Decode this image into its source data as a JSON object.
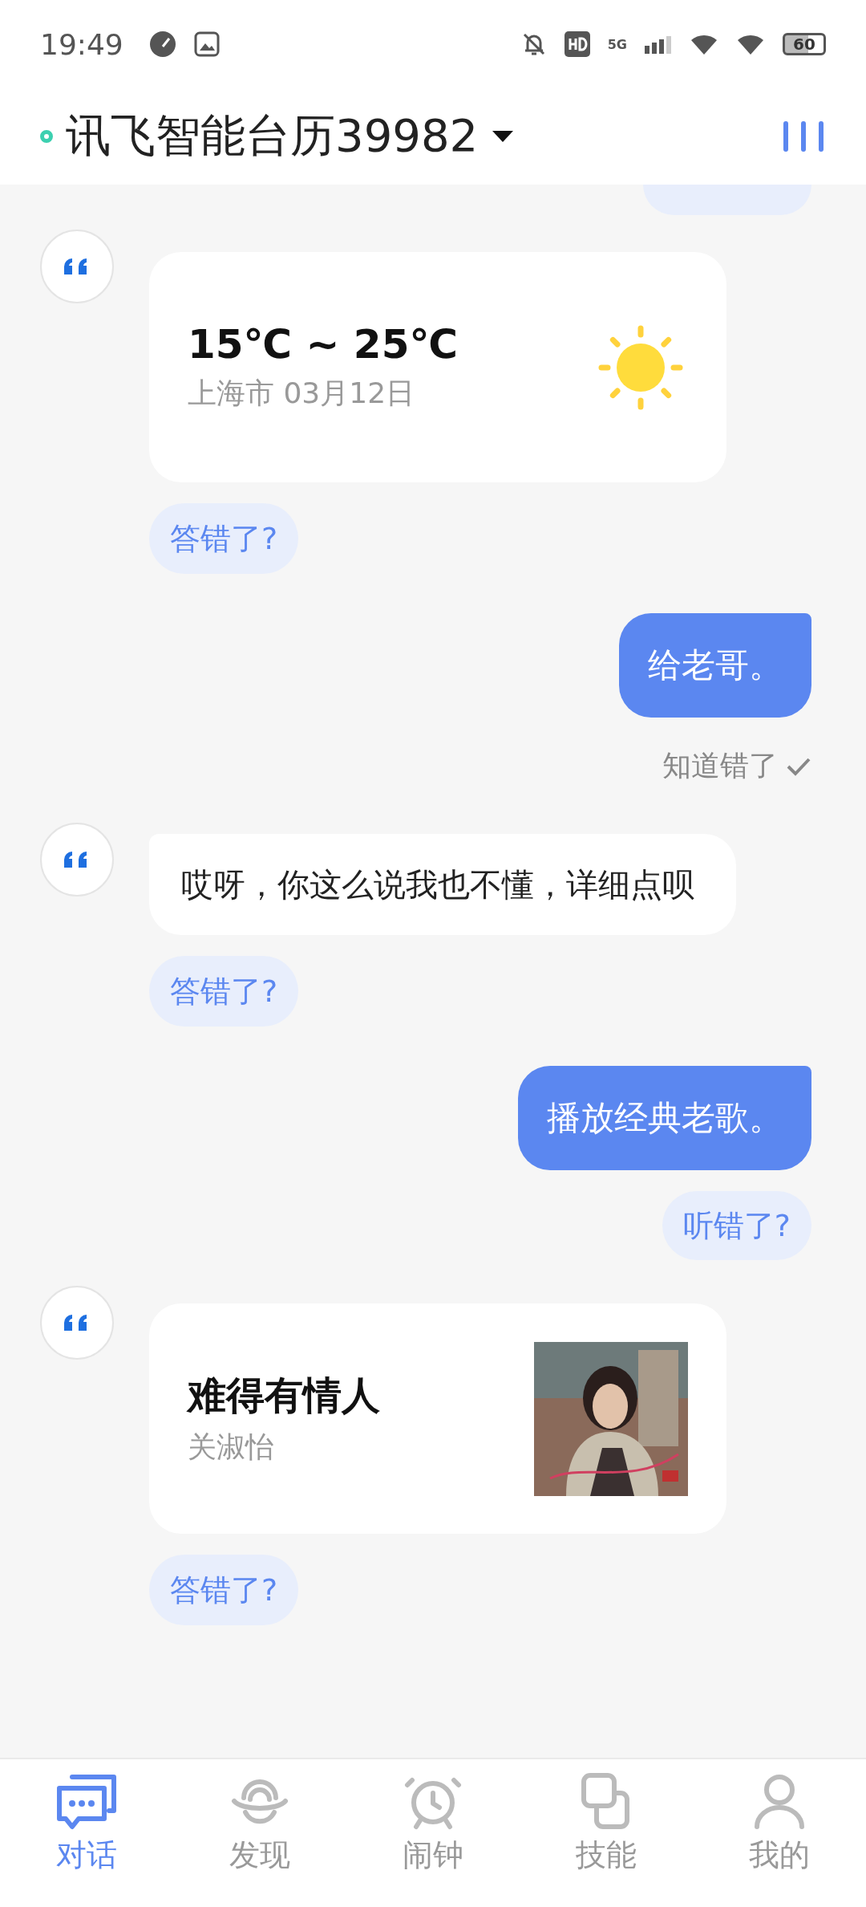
{
  "status_bar": {
    "time": "19:49",
    "network": "5G",
    "battery": "60"
  },
  "header": {
    "title": "讯飞智能台历39982",
    "online": true
  },
  "messages": [
    {
      "kind": "weather",
      "temp": "15℃ ~ 25℃",
      "location": "上海市 03月12日",
      "chip": "答错了?"
    },
    {
      "kind": "user",
      "text": "给老哥。",
      "note": "知道错了"
    },
    {
      "kind": "bot_text",
      "text": "哎呀，你这么说我也不懂，详细点呗",
      "chip": "答错了?"
    },
    {
      "kind": "user",
      "text": "播放经典老歌。",
      "chip": "听错了?"
    },
    {
      "kind": "music",
      "title": "难得有情人",
      "artist": "关淑怡",
      "chip": "答错了?"
    }
  ],
  "nav": [
    {
      "label": "对话",
      "selected": true
    },
    {
      "label": "发现",
      "selected": false
    },
    {
      "label": "闹钟",
      "selected": false
    },
    {
      "label": "技能",
      "selected": false
    },
    {
      "label": "我的",
      "selected": false
    }
  ]
}
